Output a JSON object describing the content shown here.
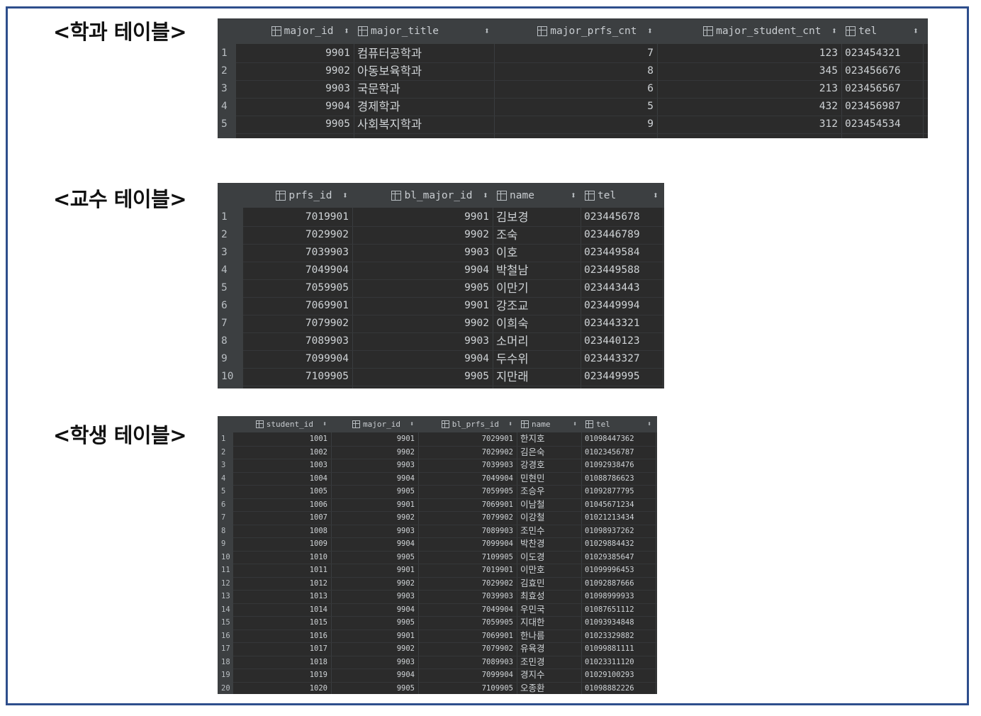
{
  "captions": {
    "major": "<학과 테이블>",
    "prof": "<교수 테이블>",
    "student": "<학생 테이블>"
  },
  "colors": {
    "frame": "#2e4e8c",
    "grid_bg": "#2b2b2b",
    "header_bg": "#3c3f41",
    "text": "#cfd3d6"
  },
  "icons": {
    "column": "table-column-icon",
    "sort": "sort-arrows-icon"
  },
  "sort_glyph": "⬍",
  "major_table": {
    "columns": [
      "major_id",
      "major_title",
      "major_prfs_cnt",
      "major_student_cnt",
      "tel"
    ],
    "rows": [
      [
        "1",
        "9901",
        "컴퓨터공학과",
        "7",
        "123",
        "023454321"
      ],
      [
        "2",
        "9902",
        "아동보육학과",
        "8",
        "345",
        "023456676"
      ],
      [
        "3",
        "9903",
        "국문학과",
        "6",
        "213",
        "023456567"
      ],
      [
        "4",
        "9904",
        "경제학과",
        "5",
        "432",
        "023456987"
      ],
      [
        "5",
        "9905",
        "사회복지학과",
        "9",
        "312",
        "023454534"
      ]
    ]
  },
  "prof_table": {
    "columns": [
      "prfs_id",
      "bl_major_id",
      "name",
      "tel"
    ],
    "rows": [
      [
        "1",
        "7019901",
        "9901",
        "김보경",
        "023445678"
      ],
      [
        "2",
        "7029902",
        "9902",
        "조숙",
        "023446789"
      ],
      [
        "3",
        "7039903",
        "9903",
        "이호",
        "023449584"
      ],
      [
        "4",
        "7049904",
        "9904",
        "박철남",
        "023449588"
      ],
      [
        "5",
        "7059905",
        "9905",
        "이만기",
        "023443443"
      ],
      [
        "6",
        "7069901",
        "9901",
        "강조교",
        "023449994"
      ],
      [
        "7",
        "7079902",
        "9902",
        "이희숙",
        "023443321"
      ],
      [
        "8",
        "7089903",
        "9903",
        "소머리",
        "023440123"
      ],
      [
        "9",
        "7099904",
        "9904",
        "두수위",
        "023443327"
      ],
      [
        "10",
        "7109905",
        "9905",
        "지만래",
        "023449995"
      ]
    ]
  },
  "student_table": {
    "columns": [
      "student_id",
      "major_id",
      "bl_prfs_id",
      "name",
      "tel"
    ],
    "rows": [
      [
        "1",
        "1001",
        "9901",
        "7029901",
        "한지호",
        "01098447362"
      ],
      [
        "2",
        "1002",
        "9902",
        "7029902",
        "김은숙",
        "01023456787"
      ],
      [
        "3",
        "1003",
        "9903",
        "7039903",
        "강경호",
        "01092938476"
      ],
      [
        "4",
        "1004",
        "9904",
        "7049904",
        "민현민",
        "01088786623"
      ],
      [
        "5",
        "1005",
        "9905",
        "7059905",
        "조승우",
        "01092877795"
      ],
      [
        "6",
        "1006",
        "9901",
        "7069901",
        "이남철",
        "01045671234"
      ],
      [
        "7",
        "1007",
        "9902",
        "7079902",
        "이강철",
        "01021213434"
      ],
      [
        "8",
        "1008",
        "9903",
        "7089903",
        "조민수",
        "01098937262"
      ],
      [
        "9",
        "1009",
        "9904",
        "7099904",
        "박찬경",
        "01029884432"
      ],
      [
        "10",
        "1010",
        "9905",
        "7109905",
        "이도경",
        "01029385647"
      ],
      [
        "11",
        "1011",
        "9901",
        "7019901",
        "이만호",
        "01099996453"
      ],
      [
        "12",
        "1012",
        "9902",
        "7029902",
        "김효민",
        "01092887666"
      ],
      [
        "13",
        "1013",
        "9903",
        "7039903",
        "최효성",
        "01098999933"
      ],
      [
        "14",
        "1014",
        "9904",
        "7049904",
        "우민국",
        "01087651112"
      ],
      [
        "15",
        "1015",
        "9905",
        "7059905",
        "지대한",
        "01093934848"
      ],
      [
        "16",
        "1016",
        "9901",
        "7069901",
        "한나름",
        "01023329882"
      ],
      [
        "17",
        "1017",
        "9902",
        "7079902",
        "유육경",
        "01099881111"
      ],
      [
        "18",
        "1018",
        "9903",
        "7089903",
        "조민경",
        "01023311120"
      ],
      [
        "19",
        "1019",
        "9904",
        "7099904",
        "경지수",
        "01029100293"
      ],
      [
        "20",
        "1020",
        "9905",
        "7109905",
        "오종환",
        "01098882226"
      ]
    ]
  }
}
